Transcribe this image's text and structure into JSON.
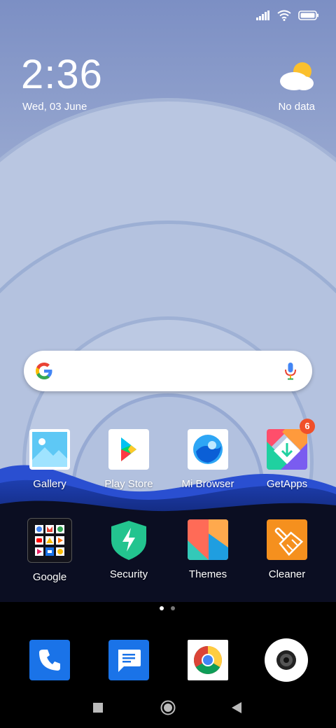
{
  "clock": {
    "time": "2:36",
    "date": "Wed, 03 June"
  },
  "weather": {
    "label": "No data",
    "icon": "partly-cloudy-icon"
  },
  "search": {
    "logo": "google-g-icon",
    "mic": "mic-icon"
  },
  "apps_row1": [
    {
      "label": "Gallery",
      "icon": "gallery-icon"
    },
    {
      "label": "Play Store",
      "icon": "play-store-icon"
    },
    {
      "label": "Mi Browser",
      "icon": "mi-browser-icon"
    },
    {
      "label": "GetApps",
      "icon": "getapps-icon",
      "badge": "6"
    }
  ],
  "apps_row2": [
    {
      "label": "Google",
      "icon": "google-folder-icon"
    },
    {
      "label": "Security",
      "icon": "security-icon"
    },
    {
      "label": "Themes",
      "icon": "themes-icon"
    },
    {
      "label": "Cleaner",
      "icon": "cleaner-icon"
    }
  ],
  "page_indicator": {
    "pages": 2,
    "current": 1
  },
  "dock": [
    {
      "icon": "phone-icon"
    },
    {
      "icon": "messages-icon"
    },
    {
      "icon": "chrome-icon"
    },
    {
      "icon": "camera-icon"
    }
  ],
  "navbar": [
    "recents-square-icon",
    "home-circle-icon",
    "back-triangle-icon"
  ]
}
